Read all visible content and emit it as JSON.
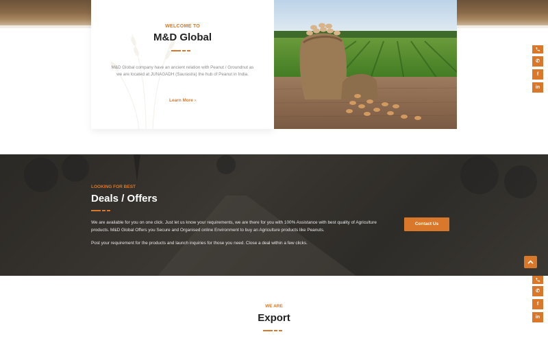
{
  "welcome": {
    "eyebrow": "WELCOME TO",
    "title": "M&D Global",
    "description": "M&D Global company have an ancient relation with Peanut / Groundnut as we are located at JUNAGADH (Saurastra) the hub of Peanut in India.",
    "learn_more": "Learn More ›"
  },
  "deals": {
    "eyebrow": "LOOKING FOR BEST",
    "title": "Deals / Offers",
    "paragraph1": "We are available for you on one click. Just let us know your requirements, we are there for you with 100% Assistance with best quality of Agriculture products. M&D Global Offers you Secure and Organised online Environment to buy an Agriculture products like Peanuts.",
    "paragraph2": "Post your requirement for the products and launch inquiries for those you need. Close a deal within a few clicks.",
    "contact_button": "Contact Us"
  },
  "export": {
    "eyebrow": "WE ARE",
    "title": "Export"
  },
  "social": {
    "whatsapp": "✆",
    "facebook": "f",
    "linkedin": "in"
  },
  "colors": {
    "accent": "#d9782b",
    "dark_bg": "#2f2c28",
    "heading": "#222222"
  },
  "icons": [
    "phone-icon",
    "whatsapp-icon",
    "facebook-icon",
    "linkedin-icon",
    "chevron-up-icon",
    "chevron-right-icon"
  ]
}
